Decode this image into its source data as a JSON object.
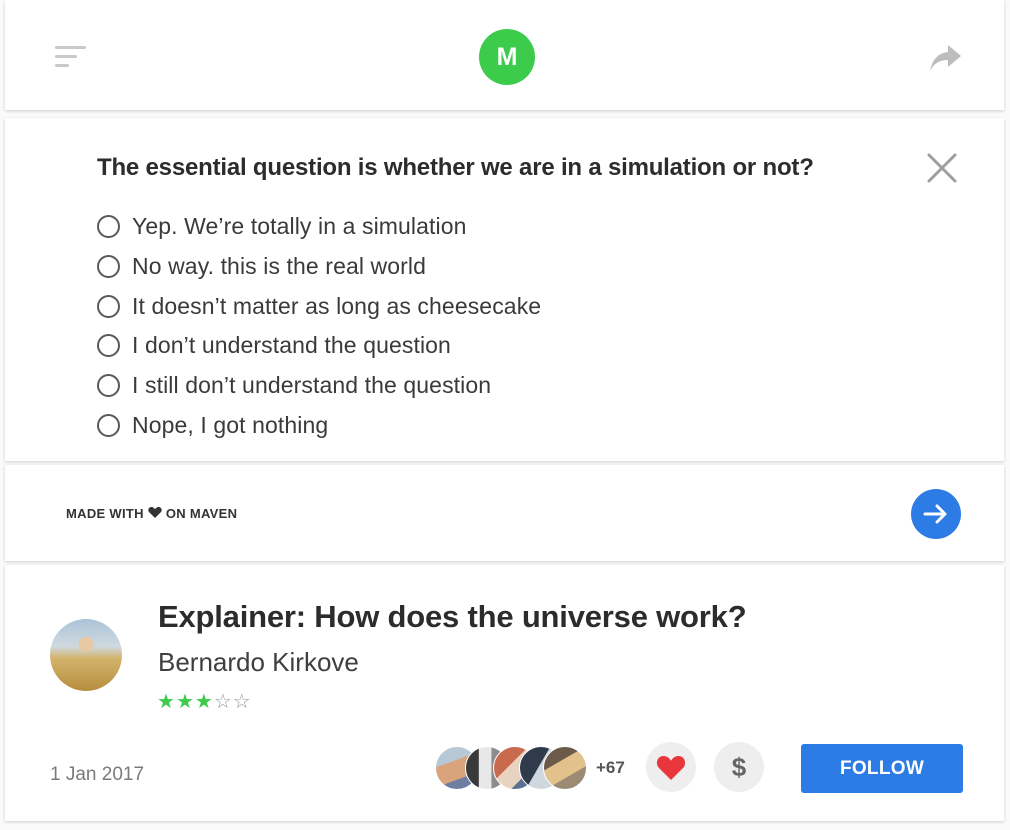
{
  "header": {
    "logo_letter": "M",
    "menu_icon": "menu-icon",
    "share_icon": "share-icon"
  },
  "poll": {
    "question": "The essential question is whether we are in a simulation or not?",
    "close_icon": "close-icon",
    "options": [
      {
        "label": "Yep. We’re totally in a simulation"
      },
      {
        "label": "No way. this is the real world"
      },
      {
        "label": "It doesn’t matter as long as cheesecake"
      },
      {
        "label": "I don’t understand the question"
      },
      {
        "label": "I still don’t understand the question"
      },
      {
        "label": "Nope, I got nothing"
      }
    ]
  },
  "footer": {
    "made_with_prefix": "MADE WITH",
    "made_with_suffix": "ON MAVEN",
    "heart_icon": "heart-icon",
    "next_icon": "arrow-right-icon"
  },
  "article": {
    "title": "Explainer: How does the universe work?",
    "author": "Bernardo Kirkove",
    "rating": 3,
    "rating_max": 5,
    "date": "1 Jan 2017",
    "more_followers": "+67",
    "like_icon": "heart-icon",
    "tip_symbol": "$",
    "follow_label": "FOLLOW"
  },
  "colors": {
    "brand_green": "#3ccb4a",
    "accent_blue": "#2d7be5",
    "like_red": "#e8363c",
    "text_dark": "#2c2c2c"
  }
}
